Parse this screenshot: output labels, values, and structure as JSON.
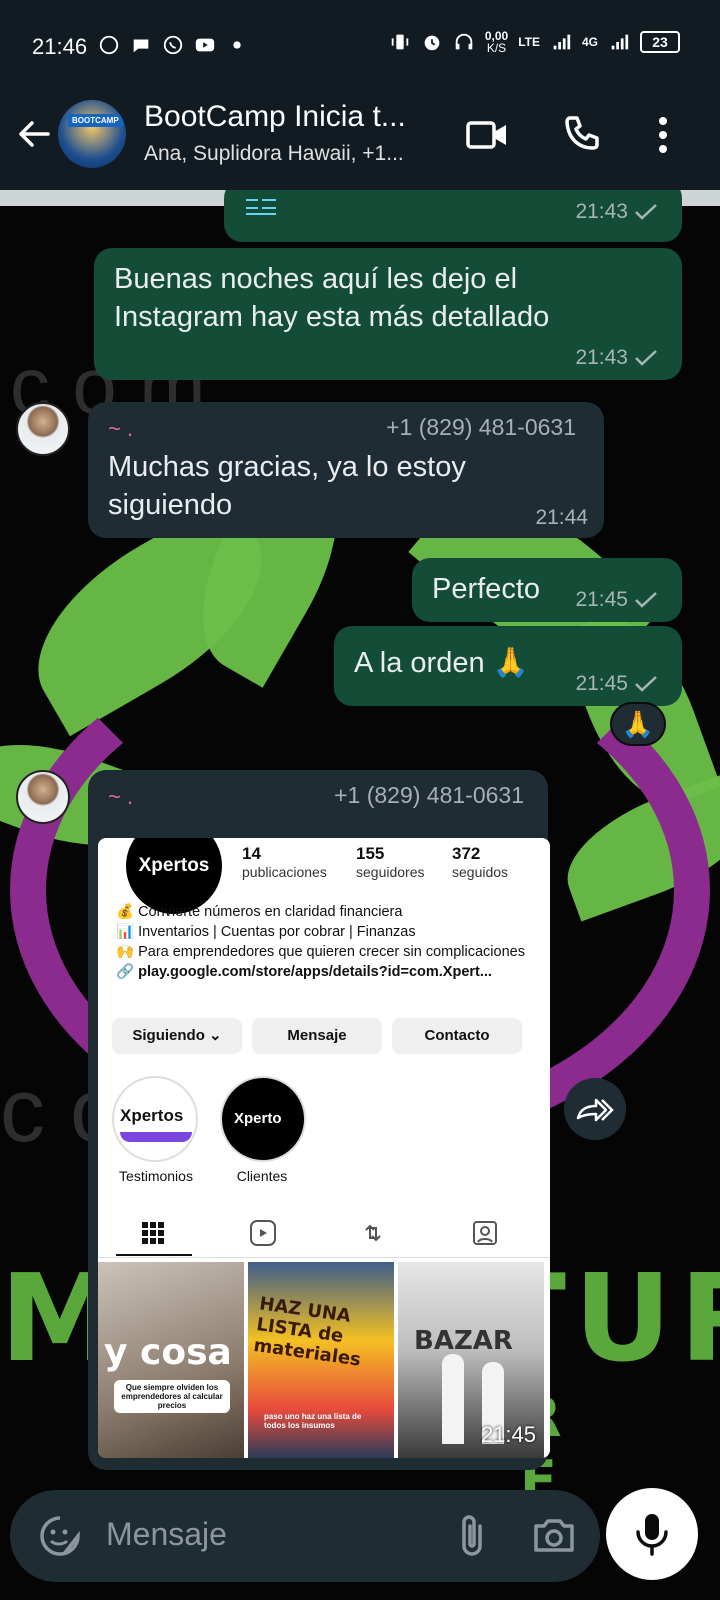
{
  "status_bar": {
    "time": "21:46",
    "net_speed": "0,00",
    "net_unit": "K/S",
    "lte": "LTE",
    "g4": "4G",
    "battery": "23"
  },
  "header": {
    "title": "BootCamp Inicia t...",
    "subtitle": "Ana, Suplidora Hawaii, +1...",
    "avatar_label": "BOOTCAMP"
  },
  "messages": [
    {
      "type": "out",
      "text": "",
      "time": "21:43"
    },
    {
      "type": "out",
      "text": "Buenas noches aquí les dejo el Instagram hay esta más detallado",
      "time": "21:43"
    },
    {
      "type": "in",
      "sender": "~ .",
      "phone": "+1 (829) 481-0631",
      "text": "Muchas gracias, ya lo estoy siguiendo",
      "time": "21:44"
    },
    {
      "type": "out",
      "text": "Perfecto",
      "time": "21:45"
    },
    {
      "type": "out",
      "text": "A la orden 🙏",
      "time": "21:45",
      "reaction": "🙏"
    },
    {
      "type": "in",
      "sender": "~ .",
      "phone": "+1 (829) 481-0631",
      "time": "21:45"
    }
  ],
  "instagram": {
    "logo": "Xpertos",
    "stats": [
      {
        "value": "14",
        "label": "publicaciones"
      },
      {
        "value": "155",
        "label": "seguidores"
      },
      {
        "value": "372",
        "label": "seguidos"
      }
    ],
    "bio_lines": [
      "💰 Convierte números en claridad financiera",
      "📊 Inventarios | Cuentas por cobrar | Finanzas",
      "🙌 Para emprendedores que quieren crecer sin complicaciones"
    ],
    "link": "play.google.com/store/apps/details?id=com.Xpert...",
    "buttons": [
      "Siguiendo ⌄",
      "Mensaje",
      "Contacto"
    ],
    "highlights": [
      {
        "label": "Testimonios",
        "logo": "Xpertos"
      },
      {
        "label": "Clientes",
        "logo": "Xperto"
      }
    ],
    "posts": [
      {
        "title": "y cosa",
        "caption": "Que siempre olviden los emprendedores al calcular precios"
      },
      {
        "title": "HAZ UNA LISTA de materiales",
        "caption": "paso uno haz una lista de todos los insumos"
      },
      {
        "title": "BAZAR",
        "caption": ""
      }
    ]
  },
  "wallpaper": {
    "text_top": "DESIGN.COM",
    "text_bottom": "MYCULTURE",
    "sub": "R E"
  },
  "input": {
    "placeholder": "Mensaje"
  },
  "colors": {
    "outgoing_bubble": "#144d37",
    "incoming_bubble": "#1f2c34",
    "header_bg": "#121b22",
    "sender_name": "#e06aa0"
  }
}
